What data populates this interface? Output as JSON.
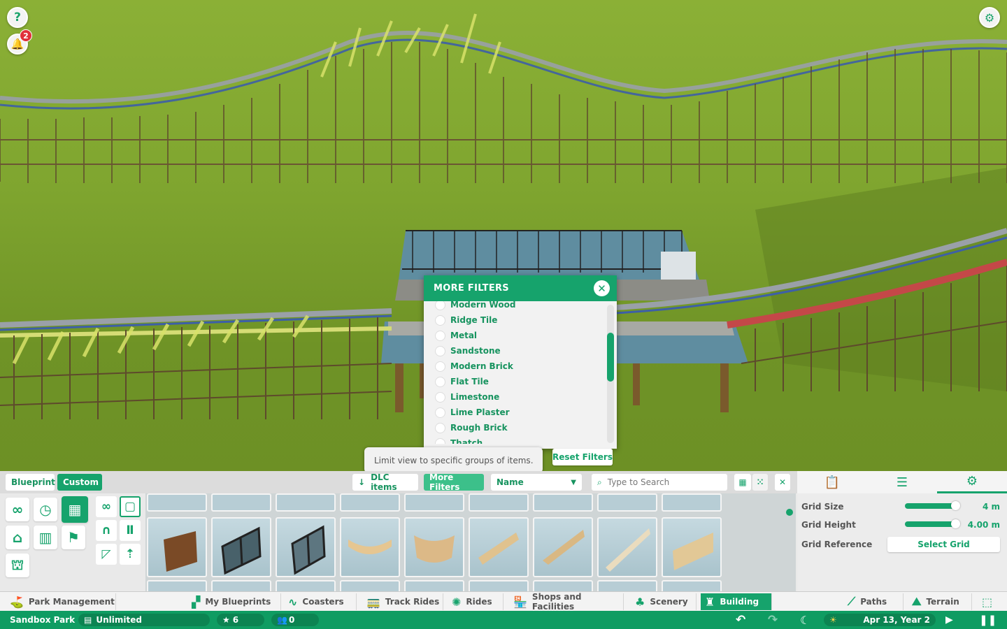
{
  "top_buttons": {
    "help": "?",
    "notifications_count": "2"
  },
  "filters": {
    "title": "MORE FILTERS",
    "close": "✕",
    "items": [
      "Modern Wood",
      "Ridge Tile",
      "Metal",
      "Sandstone",
      "Modern Brick",
      "Flat Tile",
      "Limestone",
      "Lime Plaster",
      "Rough Brick",
      "Thatch"
    ],
    "reset_label": "Reset Filters",
    "tooltip": "Limit view to specific groups of items."
  },
  "panel": {
    "tabs": [
      "Blueprint",
      "Custom"
    ],
    "dlc_label": "DLC items",
    "more_filters_label": "More Filters",
    "sort_label": "Name",
    "search_placeholder": "Type to Search"
  },
  "grid": {
    "size_label": "Grid Size",
    "size_value": "4 m",
    "height_label": "Grid Height",
    "height_value": "4.00 m",
    "reference_label": "Grid Reference",
    "select_label": "Select Grid"
  },
  "nav": {
    "park_management": "Park Management",
    "my_blueprints": "My Blueprints",
    "coasters": "Coasters",
    "track_rides": "Track Rides",
    "rides": "Rides",
    "shops": "Shops and Facilities",
    "scenery": "Scenery",
    "building": "Building",
    "paths": "Paths",
    "terrain": "Terrain"
  },
  "status": {
    "park_name": "Sandbox Park",
    "money": "Unlimited",
    "rating": "6",
    "guests": "0",
    "date": "Apr 13, Year 2"
  },
  "colors": {
    "accent": "#16a36c",
    "status_bar": "#0f9c62"
  }
}
